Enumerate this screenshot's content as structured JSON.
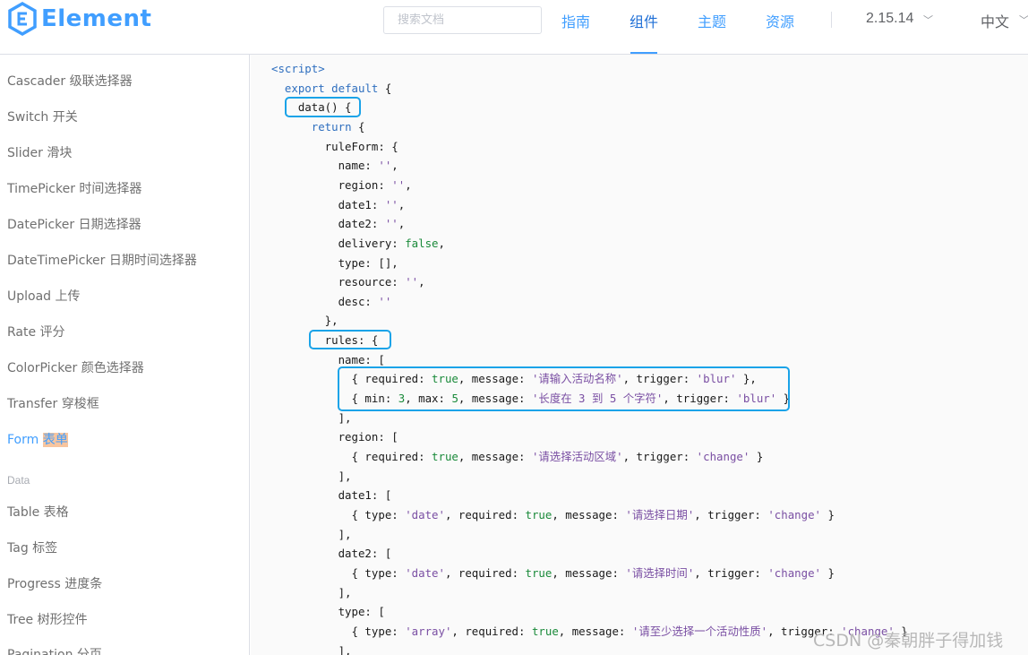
{
  "header": {
    "logo_text": "Element",
    "search_placeholder": "搜索文档",
    "nav": [
      "指南",
      "组件",
      "主题",
      "资源"
    ],
    "active_nav": "组件",
    "version": "2.15.14",
    "language": "中文"
  },
  "sidebar": {
    "items": [
      "Cascader 级联选择器",
      "Switch 开关",
      "Slider 滑块",
      "TimePicker 时间选择器",
      "DatePicker 日期选择器",
      "DateTimePicker 日期时间选择器",
      "Upload 上传",
      "Rate 评分",
      "ColorPicker 颜色选择器",
      "Transfer 穿梭框"
    ],
    "active_item": {
      "name": "Form",
      "label": "表单"
    },
    "group_label": "Data",
    "group_items": [
      "Table 表格",
      "Tag 标签",
      "Progress 进度条",
      "Tree 树形控件",
      "Pagination 分页"
    ]
  },
  "code": {
    "lines": [
      "<script>",
      "  export default {",
      "    data() {",
      "      return {",
      "        ruleForm: {",
      "          name: '',",
      "          region: '',",
      "          date1: '',",
      "          date2: '',",
      "          delivery: false,",
      "          type: [],",
      "          resource: '',",
      "          desc: ''",
      "        },",
      "        rules: {",
      "          name: [",
      "            { required: true, message: '请输入活动名称', trigger: 'blur' },",
      "            { min: 3, max: 5, message: '长度在 3 到 5 个字符', trigger: 'blur' }",
      "          ],",
      "          region: [",
      "            { required: true, message: '请选择活动区域', trigger: 'change' }",
      "          ],",
      "          date1: [",
      "            { type: 'date', required: true, message: '请选择日期', trigger: 'change' }",
      "          ],",
      "          date2: [",
      "            { type: 'date', required: true, message: '请选择时间', trigger: 'change' }",
      "          ],",
      "          type: [",
      "            { type: 'array', required: true, message: '请至少选择一个活动性质', trigger: 'change' }",
      "          ],"
    ]
  },
  "watermark": "CSDN @秦朝胖子得加钱",
  "colors": {
    "accent": "#409eff",
    "highlight_box": "#1aa3e8",
    "active_highlight": "#f7c59f"
  }
}
